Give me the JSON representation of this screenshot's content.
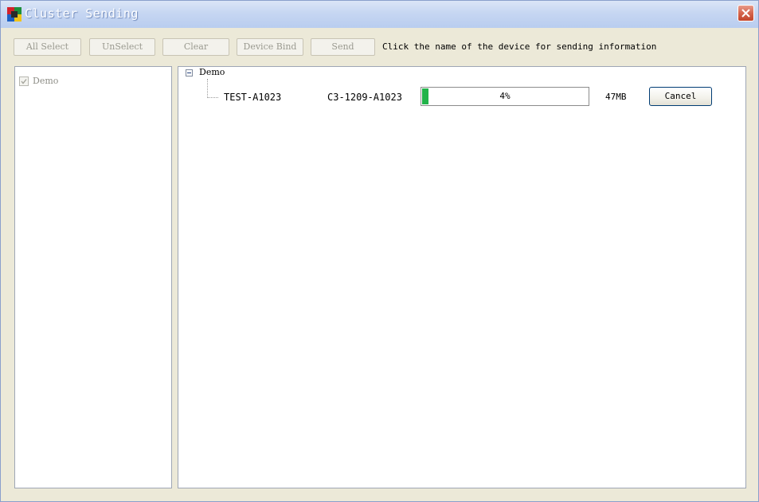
{
  "window": {
    "title": "Cluster Sending"
  },
  "toolbar": {
    "buttons": [
      {
        "label": "All Select"
      },
      {
        "label": "UnSelect"
      },
      {
        "label": "Clear"
      },
      {
        "label": "Device Bind"
      },
      {
        "label": "Send"
      }
    ],
    "hint": "Click the name of the device for sending information"
  },
  "groups_panel": {
    "items": [
      {
        "label": "Demo",
        "checked": true,
        "disabled": true
      }
    ]
  },
  "sending_panel": {
    "tree_root": {
      "label": "Demo",
      "expanded": true
    },
    "devices": [
      {
        "name": "TEST-A1023",
        "id": "C3-1209-A1023",
        "progress_percent": 4,
        "progress_label": "4%",
        "size": "47MB",
        "cancel_label": "Cancel"
      }
    ]
  },
  "colors": {
    "progress_fill": "#22b34a",
    "title_text": "#ffffff",
    "close_button": "#d4644d",
    "disabled_text": "#9a9a90"
  },
  "icons": {
    "app": "app-color-grid-icon",
    "close": "close-icon",
    "checkbox": "check-icon",
    "tree_toggle": "collapse-minus-icon"
  }
}
